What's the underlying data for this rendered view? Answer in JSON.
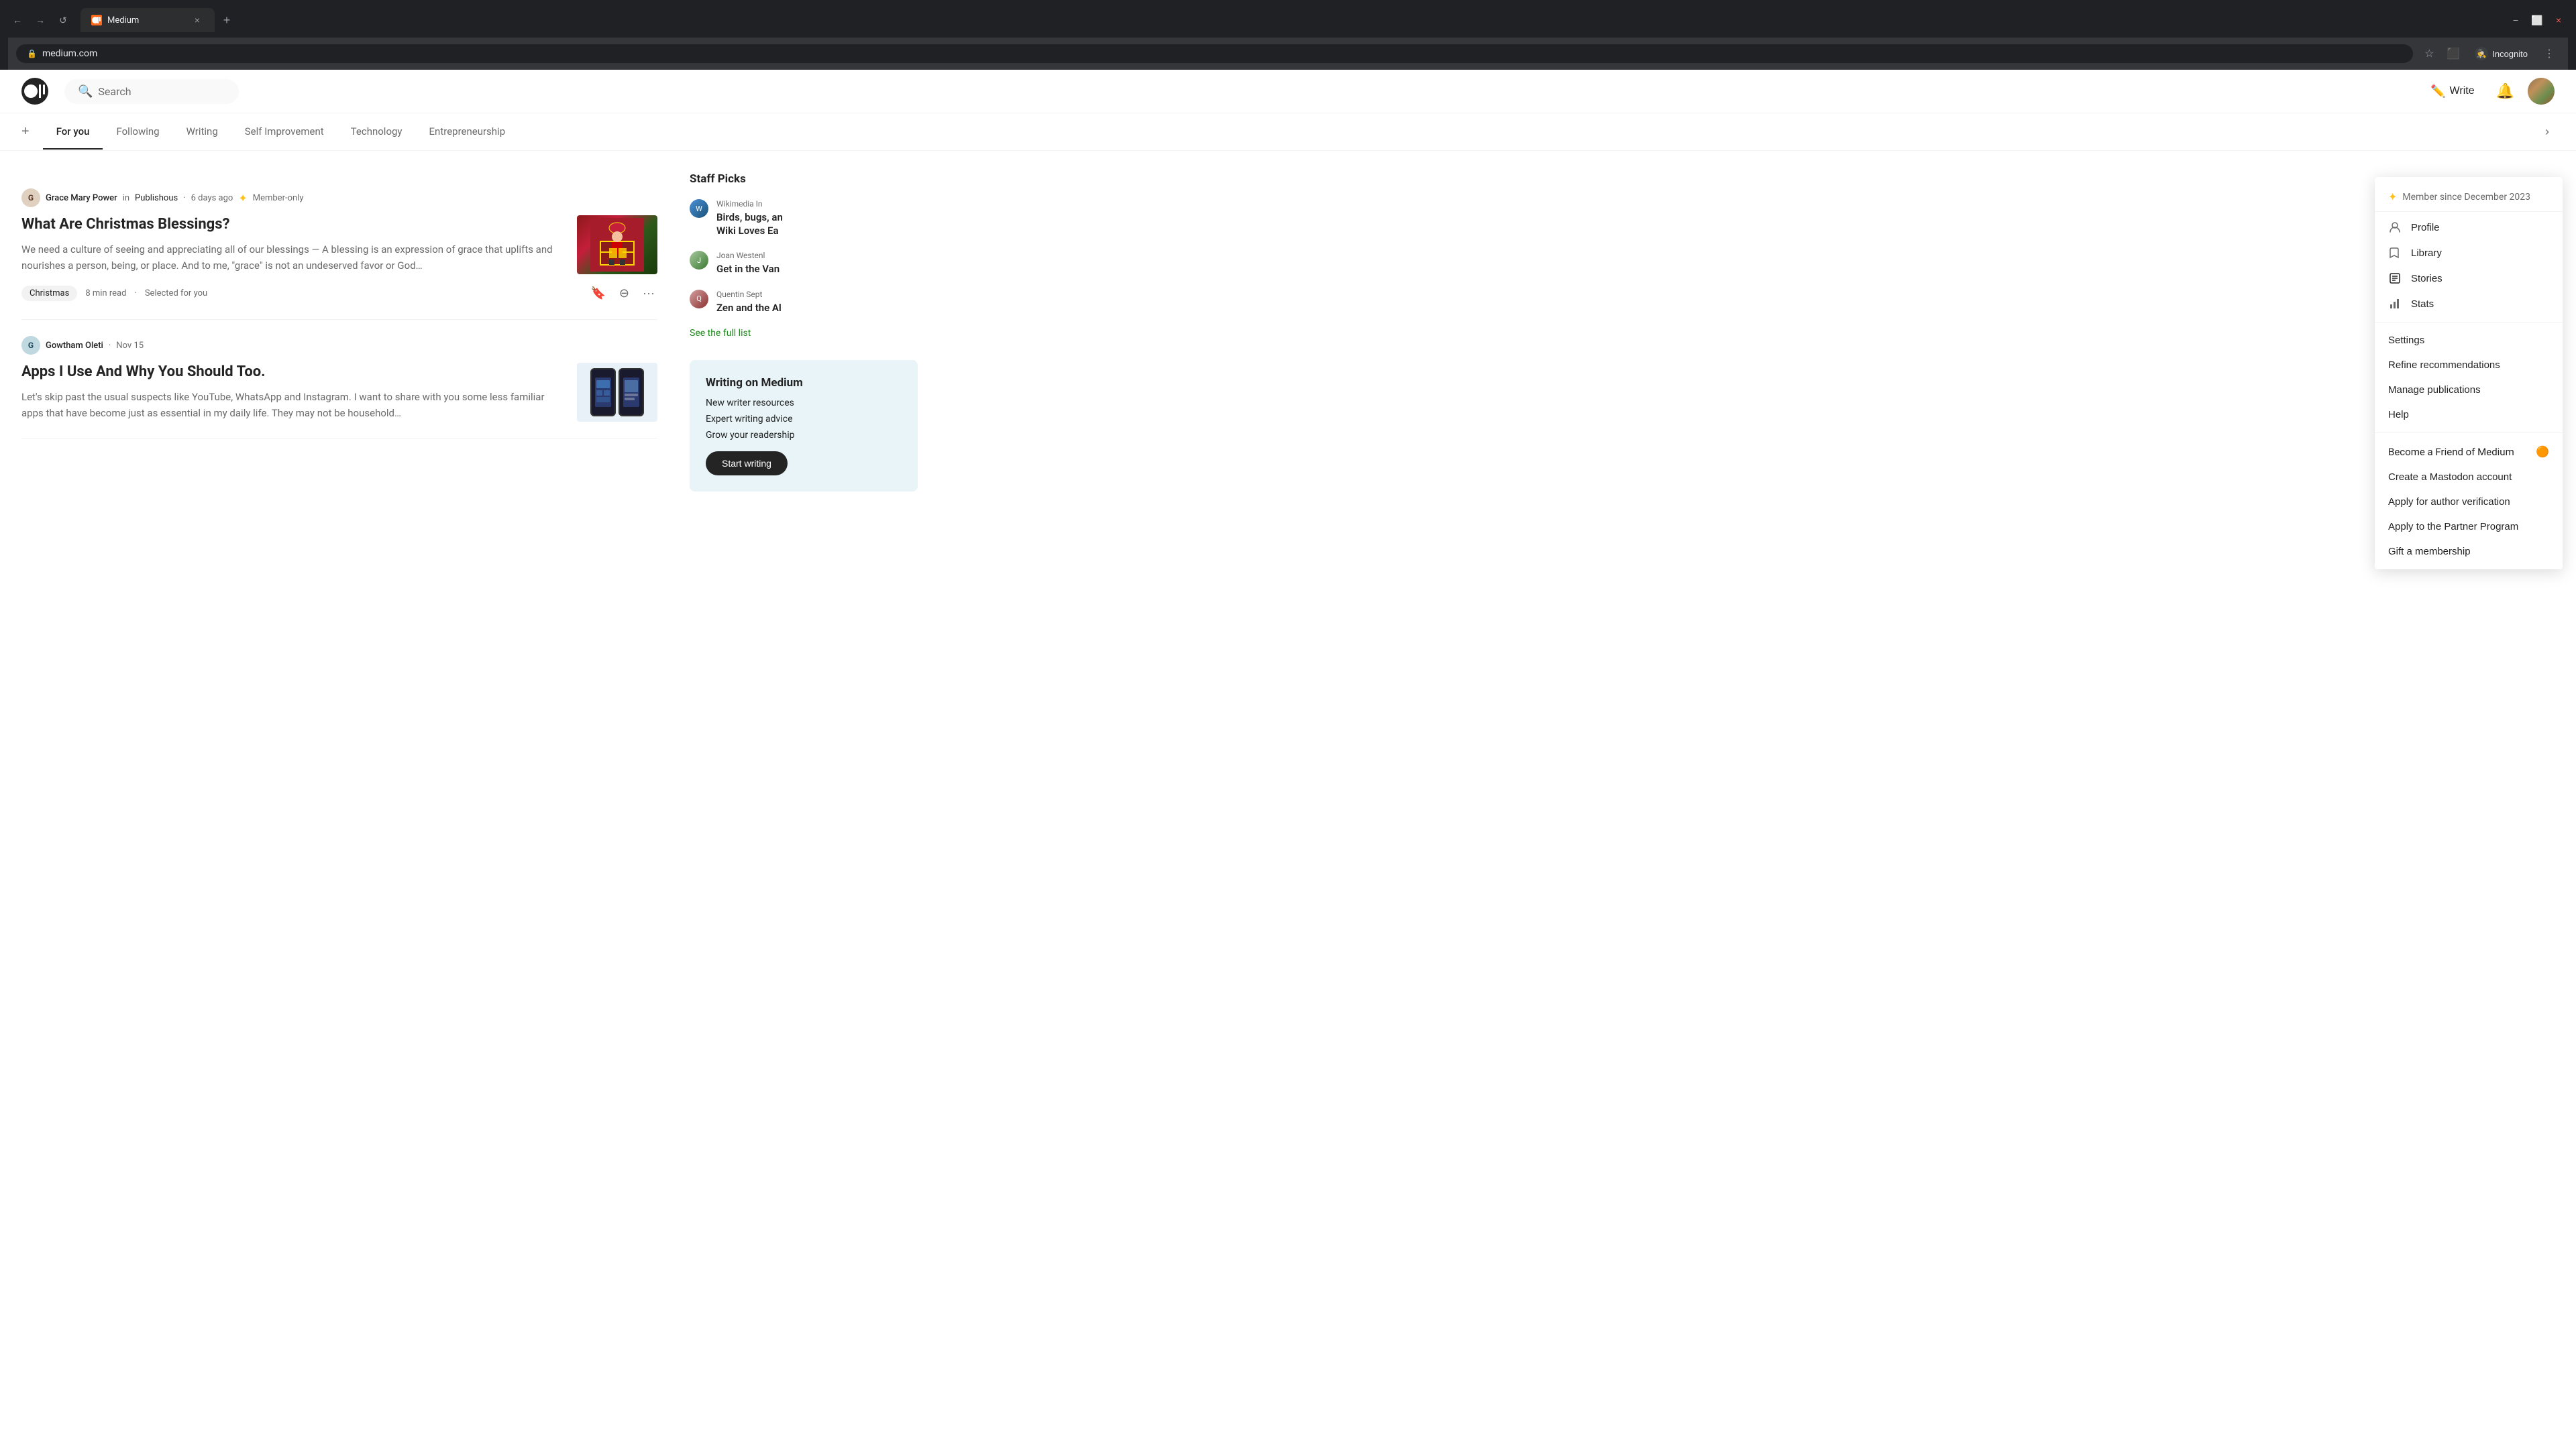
{
  "browser": {
    "tab_favicon": "M",
    "tab_title": "Medium",
    "tab_close": "×",
    "new_tab": "+",
    "nav_back": "←",
    "nav_forward": "→",
    "nav_refresh": "↺",
    "address": "medium.com",
    "bookmark_icon": "☆",
    "extensions_icon": "⬛",
    "incognito_label": "Incognito",
    "more_icon": "⋮",
    "window_minimize": "−",
    "window_maximize": "⬜",
    "window_close": "×"
  },
  "header": {
    "search_placeholder": "Search",
    "write_label": "Write",
    "logo_text": "M"
  },
  "nav": {
    "add_icon": "+",
    "tabs": [
      {
        "label": "For you",
        "active": true
      },
      {
        "label": "Following",
        "active": false
      },
      {
        "label": "Writing",
        "active": false
      },
      {
        "label": "Self Improvement",
        "active": false
      },
      {
        "label": "Technology",
        "active": false
      },
      {
        "label": "Entrepreneurship",
        "active": false
      }
    ],
    "arrow_icon": "›"
  },
  "articles": [
    {
      "author_name": "Grace Mary Power",
      "author_initials": "G",
      "publication": "Publishous",
      "time_ago": "6 days ago",
      "member_only": true,
      "title": "What Are Christmas Blessings?",
      "excerpt": "We need a culture of seeing and appreciating all of our blessings — A blessing is an expression of grace that uplifts and nourishes a person, being, or place. And to me, \"grace\" is not an undeserved favor or God…",
      "tag": "Christmas",
      "read_time": "8 min read",
      "selected_for_you": "Selected for you",
      "thumb_type": "christmas"
    },
    {
      "author_name": "Gowtham Oleti",
      "author_initials": "G",
      "publication": "",
      "time_ago": "Nov 15",
      "member_only": false,
      "title": "Apps I Use And Why You Should Too.",
      "excerpt": "Let's skip past the usual suspects like YouTube, WhatsApp and Instagram. I want to share with you some less familiar apps that have become just as essential in my daily life. They may not be household…",
      "tag": "",
      "read_time": "",
      "selected_for_you": "",
      "thumb_type": "apps"
    }
  ],
  "staff_picks": {
    "title": "Staff Picks",
    "items": [
      {
        "author_initials": "W",
        "author_name": "Wikimedia In",
        "title": "Birds, bugs, an Wiki Loves Ea",
        "avatar_class": "wiki"
      },
      {
        "author_initials": "J",
        "author_name": "Joan Westenl",
        "title": "Get in the Van",
        "avatar_class": "joan"
      },
      {
        "author_initials": "Q",
        "author_name": "Quentin Sept",
        "title": "Zen and the Al",
        "avatar_class": "quentin"
      }
    ],
    "see_full_list": "See the full list"
  },
  "writing_on_medium": {
    "title": "Writing on Medium",
    "items": [
      "New writer resources",
      "Expert writing advice",
      "Grow your readership"
    ],
    "start_writing_label": "Start writing"
  },
  "dropdown": {
    "member_since": "Member since December 2023",
    "star_icon": "✦",
    "items": [
      {
        "icon": "👤",
        "label": "Profile",
        "type": "icon"
      },
      {
        "icon": "🔖",
        "label": "Library",
        "type": "icon"
      },
      {
        "icon": "📄",
        "label": "Stories",
        "type": "icon",
        "active": true
      },
      {
        "icon": "📊",
        "label": "Stats",
        "type": "icon"
      }
    ],
    "settings_items": [
      {
        "label": "Settings"
      },
      {
        "label": "Refine recommendations"
      },
      {
        "label": "Manage publications"
      },
      {
        "label": "Help"
      }
    ],
    "extra_items": [
      {
        "label": "Become a Friend of Medium",
        "badge": "🟠"
      },
      {
        "label": "Create a Mastodon account"
      },
      {
        "label": "Apply for author verification"
      },
      {
        "label": "Apply to the Partner Program"
      },
      {
        "label": "Gift a membership"
      }
    ]
  }
}
